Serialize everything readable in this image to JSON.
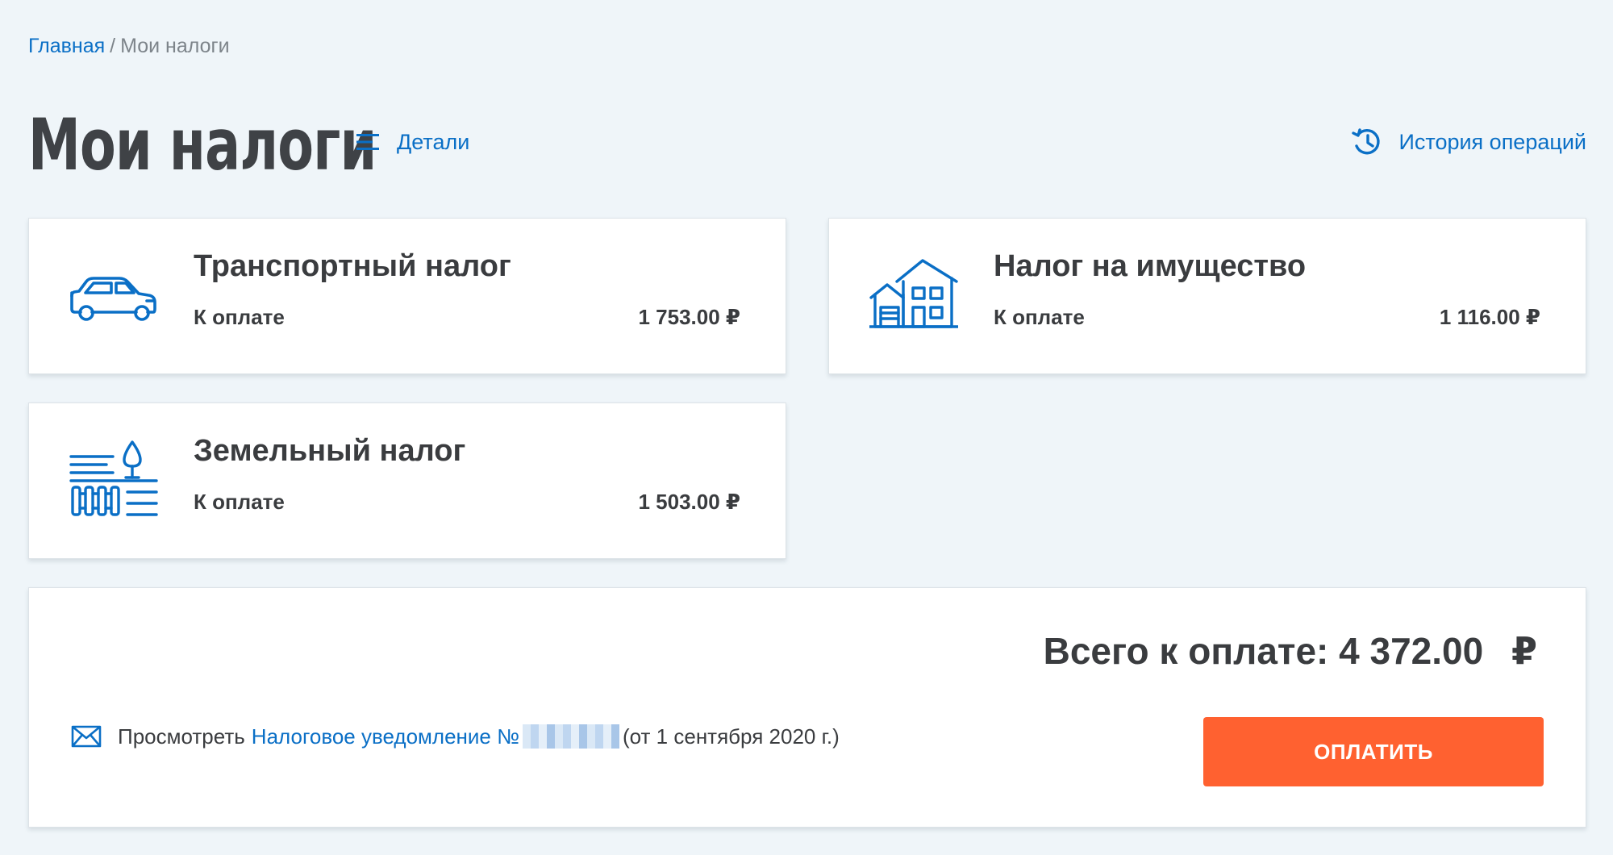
{
  "breadcrumb": {
    "home": "Главная",
    "separator": "/",
    "current": "Мои налоги"
  },
  "page": {
    "title": "Мои налоги",
    "details_label": "Детали",
    "history_label": "История операций"
  },
  "colors": {
    "accent": "#0a6fc6",
    "pay_button": "#ff6130",
    "background": "#eff5f9"
  },
  "taxes": [
    {
      "title": "Транспортный налог",
      "due_label": "К оплате",
      "amount": "1 753.00 ₽",
      "icon": "car-icon"
    },
    {
      "title": "Налог на имущество",
      "due_label": "К оплате",
      "amount": "1 116.00 ₽",
      "icon": "house-icon"
    },
    {
      "title": "Земельный налог",
      "due_label": "К оплате",
      "amount": "1 503.00 ₽",
      "icon": "land-plot-icon"
    }
  ],
  "summary": {
    "total_label": "Всего к оплате:",
    "total_value": "4 372.00",
    "currency": "₽",
    "notice_prefix": "Просмотреть",
    "notice_link": "Налоговое уведомление №",
    "notice_date": "(от 1 сентября 2020 г.)",
    "pay_button": "ОПЛАТИТЬ"
  }
}
